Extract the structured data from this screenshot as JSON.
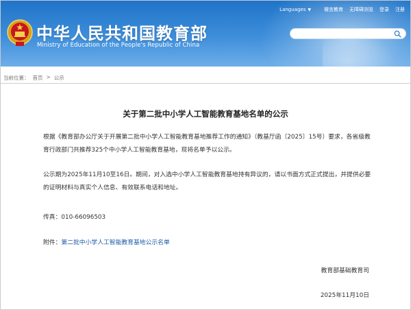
{
  "header": {
    "site_title": "中华人民共和国教育部",
    "site_subtitle": "Ministry of Education of the People's Republic of China",
    "top_links": {
      "languages": "Languages",
      "weibo": "微言教育",
      "accessible": "无障碍浏览",
      "login": "登录",
      "register": "注册"
    },
    "search": {
      "placeholder": ""
    }
  },
  "breadcrumb": {
    "prefix": "当前位置：",
    "home": "首页",
    "separator": ">",
    "current": "公示"
  },
  "article": {
    "title": "关于第二批中小学人工智能教育基地名单的公示",
    "paragraph1": "根据《教育部办公厅关于开展第二批中小学人工智能教育基地推荐工作的通知》（教基厅函〔2025〕15号）要求，各省级教育行政部门共推荐325个中小学人工智能教育基地，现将名单予以公示。",
    "paragraph2": "公示期为2025年11月10至16日。期间，对入选中小学人工智能教育基地持有异议的，请以书面方式正式提出，并提供必要的证明材料与真实个人信息、有效联系电话和地址。",
    "fax": "传真：010-66096503",
    "attachment_label": "附件：",
    "attachment_link": "第二批中小学人工智能教育基地公示名单",
    "signature_org": "教育部基础教育司",
    "signature_date": "2025年11月10日"
  },
  "colors": {
    "header_blue": "#1f74c8",
    "link_blue": "#1a5aa6"
  },
  "icons": [
    "national-emblem-icon",
    "search-icon",
    "caret-down-icon"
  ]
}
